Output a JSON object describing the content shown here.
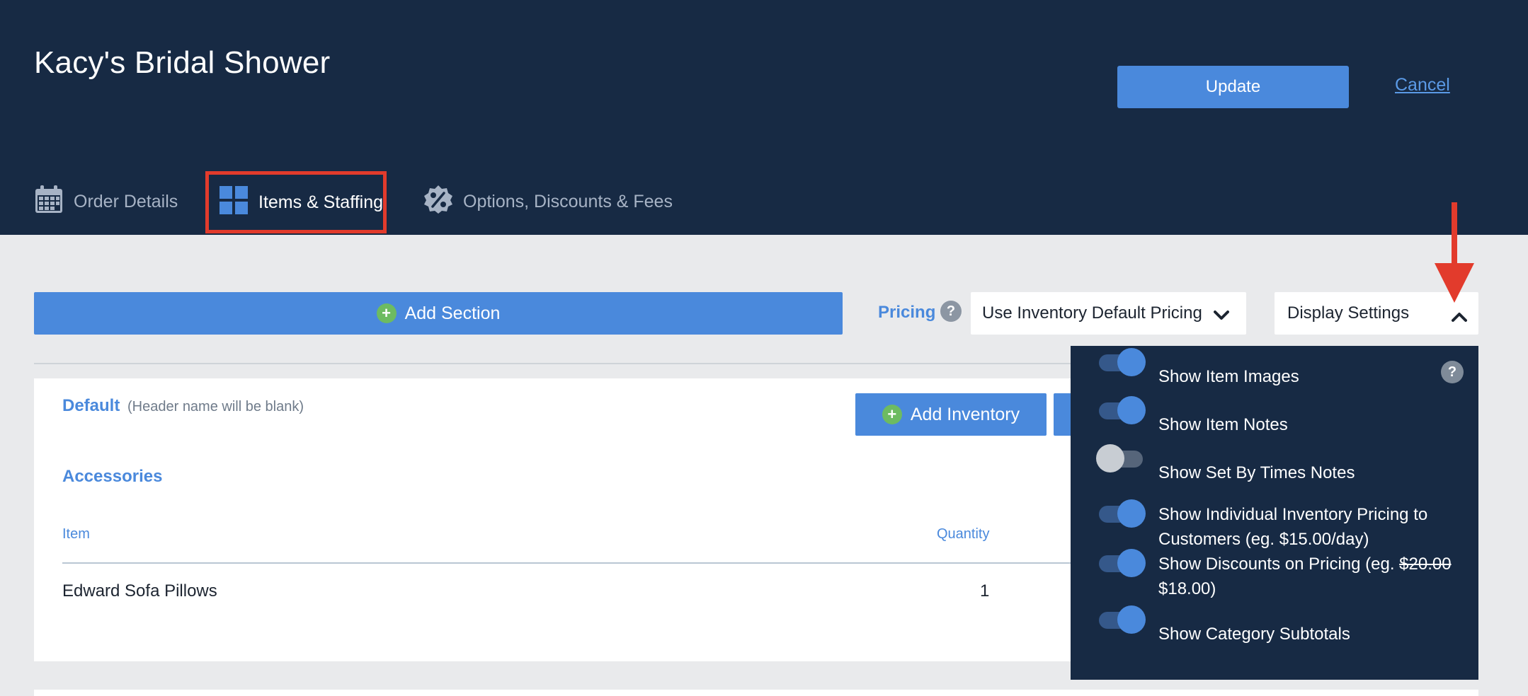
{
  "header": {
    "title": "Kacy's Bridal Shower",
    "update_label": "Update",
    "cancel_label": "Cancel",
    "tabs": [
      {
        "label": "Order Details",
        "icon": "calendar-icon"
      },
      {
        "label": "Items & Staffing",
        "icon": "grid-icon",
        "active": true
      },
      {
        "label": "Options, Discounts & Fees",
        "icon": "percent-badge-icon"
      }
    ]
  },
  "toolbar": {
    "add_section_label": "Add Section",
    "pricing_label": "Pricing",
    "pricing_help": "?",
    "pricing_selected": "Use Inventory Default Pricing",
    "display_settings_label": "Display Settings"
  },
  "section": {
    "name": "Default",
    "note": "(Header name will be blank)",
    "add_inventory_label": "Add Inventory",
    "category": "Accessories",
    "columns": [
      "Item",
      "Quantity"
    ],
    "rows": [
      {
        "item": "Edward Sofa Pillows",
        "quantity": "1"
      }
    ]
  },
  "display_settings": {
    "help": "?",
    "options": [
      {
        "label": "Show Item Images",
        "on": true
      },
      {
        "label": "Show Item Notes",
        "on": true
      },
      {
        "label": "Show Set By Times Notes",
        "on": false
      },
      {
        "label": "Show Individual Inventory Pricing to Customers (eg. $15.00/day)",
        "on": true
      },
      {
        "label_prefix": "Show Discounts on Pricing (eg. ",
        "label_strike": "$20.00",
        "label_suffix": "$18.00)",
        "on": true
      },
      {
        "label": "Show Category Subtotals",
        "on": true
      }
    ]
  },
  "colors": {
    "header_bg": "#172a44",
    "primary": "#4a89dc",
    "annotation_red": "#e23b2c",
    "plus_green": "#6dbb61"
  }
}
